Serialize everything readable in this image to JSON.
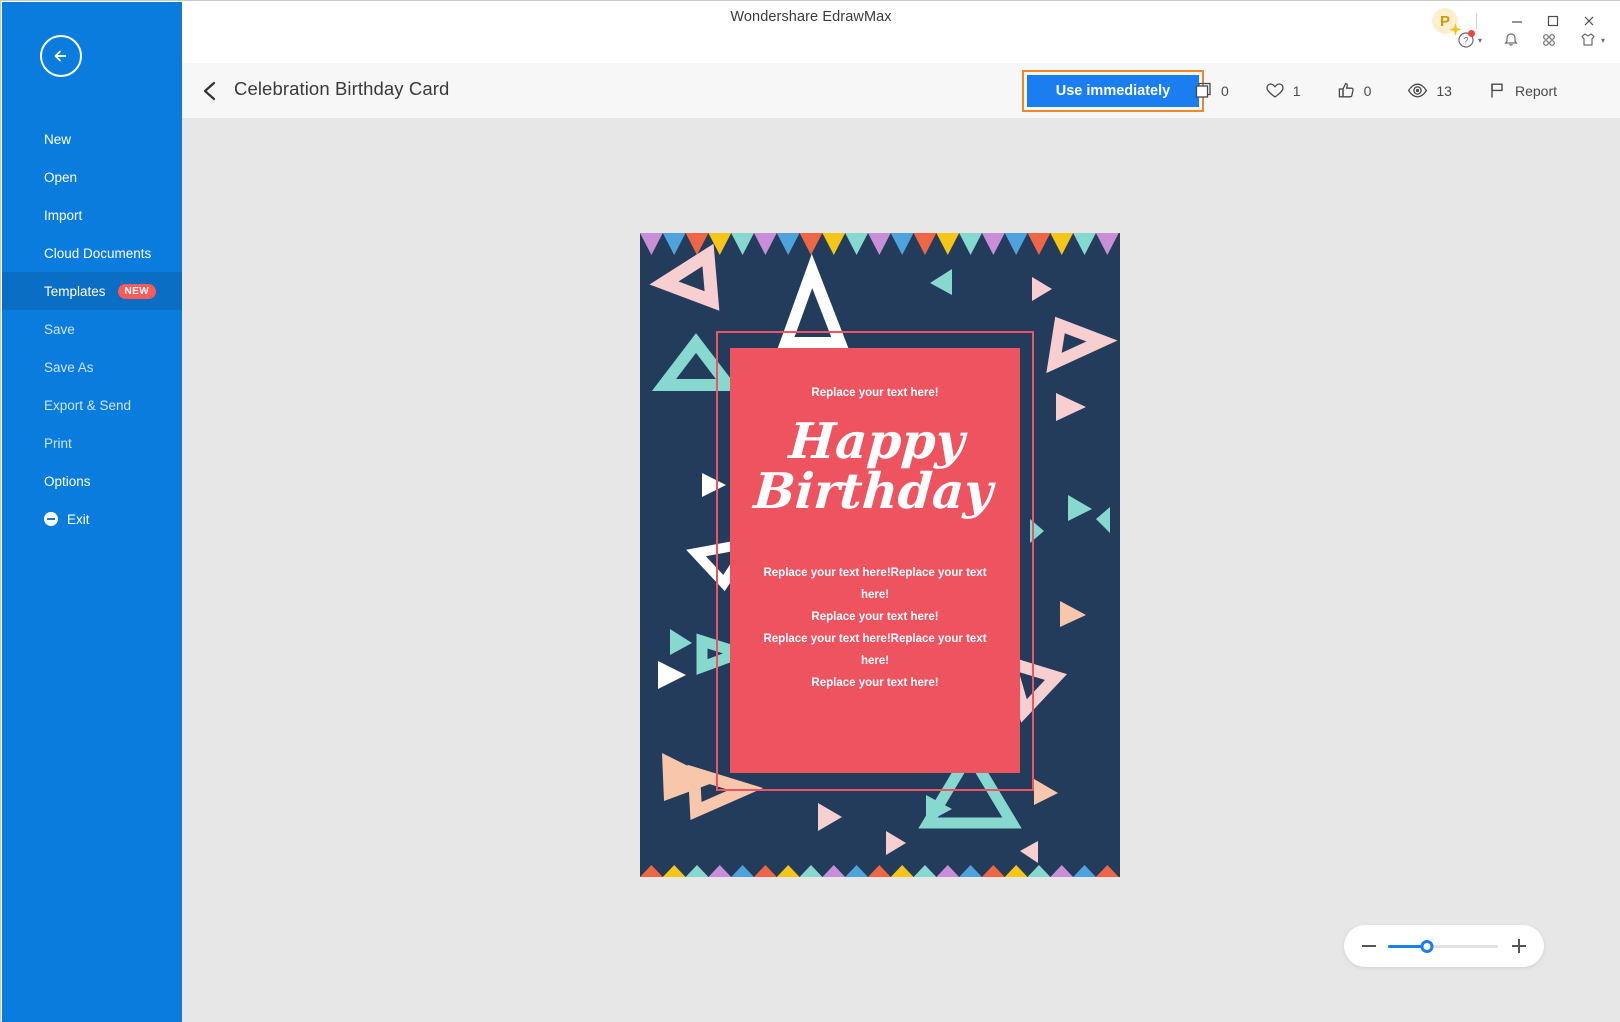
{
  "window": {
    "title": "Wondershare EdrawMax",
    "pro_badge": "P",
    "minimize": "minimize-icon",
    "maximize": "maximize-icon",
    "close": "close-icon",
    "help": "help-icon",
    "notification": "bell-icon",
    "apps": "grid-icon",
    "theme": "theme-icon"
  },
  "sidebar": {
    "back": "back-arrow-icon",
    "items": [
      {
        "label": "New",
        "state": "normal"
      },
      {
        "label": "Open",
        "state": "normal"
      },
      {
        "label": "Import",
        "state": "normal"
      },
      {
        "label": "Cloud Documents",
        "state": "normal"
      },
      {
        "label": "Templates",
        "state": "active",
        "badge": "NEW"
      },
      {
        "label": "Save",
        "state": "dim"
      },
      {
        "label": "Save As",
        "state": "dim"
      },
      {
        "label": "Export & Send",
        "state": "dim"
      },
      {
        "label": "Print",
        "state": "dim"
      },
      {
        "label": "Options",
        "state": "normal"
      },
      {
        "label": "Exit",
        "state": "exit"
      }
    ]
  },
  "header": {
    "back": "chevron-left-icon",
    "title": "Celebration Birthday Card",
    "use_button": "Use immediately",
    "stats": [
      {
        "icon": "copy-icon",
        "value": "0"
      },
      {
        "icon": "heart-icon",
        "value": "1"
      },
      {
        "icon": "thumbs-up-icon",
        "value": "0"
      },
      {
        "icon": "eye-icon",
        "value": "13"
      }
    ],
    "report_label": "Report",
    "report_icon": "flag-icon"
  },
  "card": {
    "top_text": "Replace your text here!",
    "headline_line1": "Happy",
    "headline_line2": "Birthday",
    "body_lines": [
      "Replace your text here!Replace your text",
      "here!",
      "Replace your text here!",
      "Replace your text here!Replace your text",
      "here!",
      "Replace your text here!"
    ],
    "colors": {
      "background": "#233c5c",
      "panel": "#ee5360",
      "frame": "#ed5565",
      "bunting": [
        "#c88ed6",
        "#4fa3dd",
        "#ee6644",
        "#f5c518",
        "#87d9cf"
      ],
      "deco_pink": "#f7cfd0",
      "deco_peach": "#f7c6ab",
      "deco_teal": "#87d9cf",
      "deco_white": "#ffffff"
    }
  },
  "zoom": {
    "minus": "minus-icon",
    "plus": "plus-icon",
    "value": 35
  },
  "theme": {
    "accent": "#1a7df0",
    "sidebar": "#0a7cde",
    "sidebar_active": "#0a6ec4",
    "highlight_border": "#f18825",
    "badge": "#fb5a5a",
    "canvas": "#e7e7e7"
  }
}
